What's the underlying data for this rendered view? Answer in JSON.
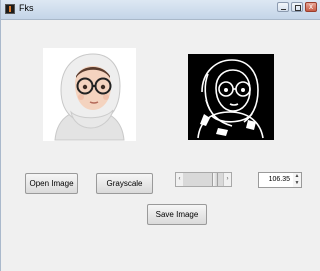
{
  "window": {
    "title": "Fks",
    "controls": {
      "minimize_icon": "minimize-icon",
      "maximize_icon": "maximize-icon",
      "close_icon": "close-icon",
      "close_glyph": "x"
    }
  },
  "images": {
    "original_icon": "hijab-avatar-color",
    "processed_icon": "hijab-avatar-edge"
  },
  "buttons": {
    "open_label": "Open Image",
    "grayscale_label": "Grayscale",
    "save_label": "Save Image"
  },
  "slider": {
    "left_arrow": "‹",
    "right_arrow": "›",
    "position_fraction": 0.84
  },
  "spinbox": {
    "value": "106.35",
    "up_arrow": "▲",
    "down_arrow": "▼"
  },
  "colors": {
    "titlebar": "#c4d5e8",
    "window_bg": "#f0f0f0",
    "close_button": "#c75c45"
  }
}
